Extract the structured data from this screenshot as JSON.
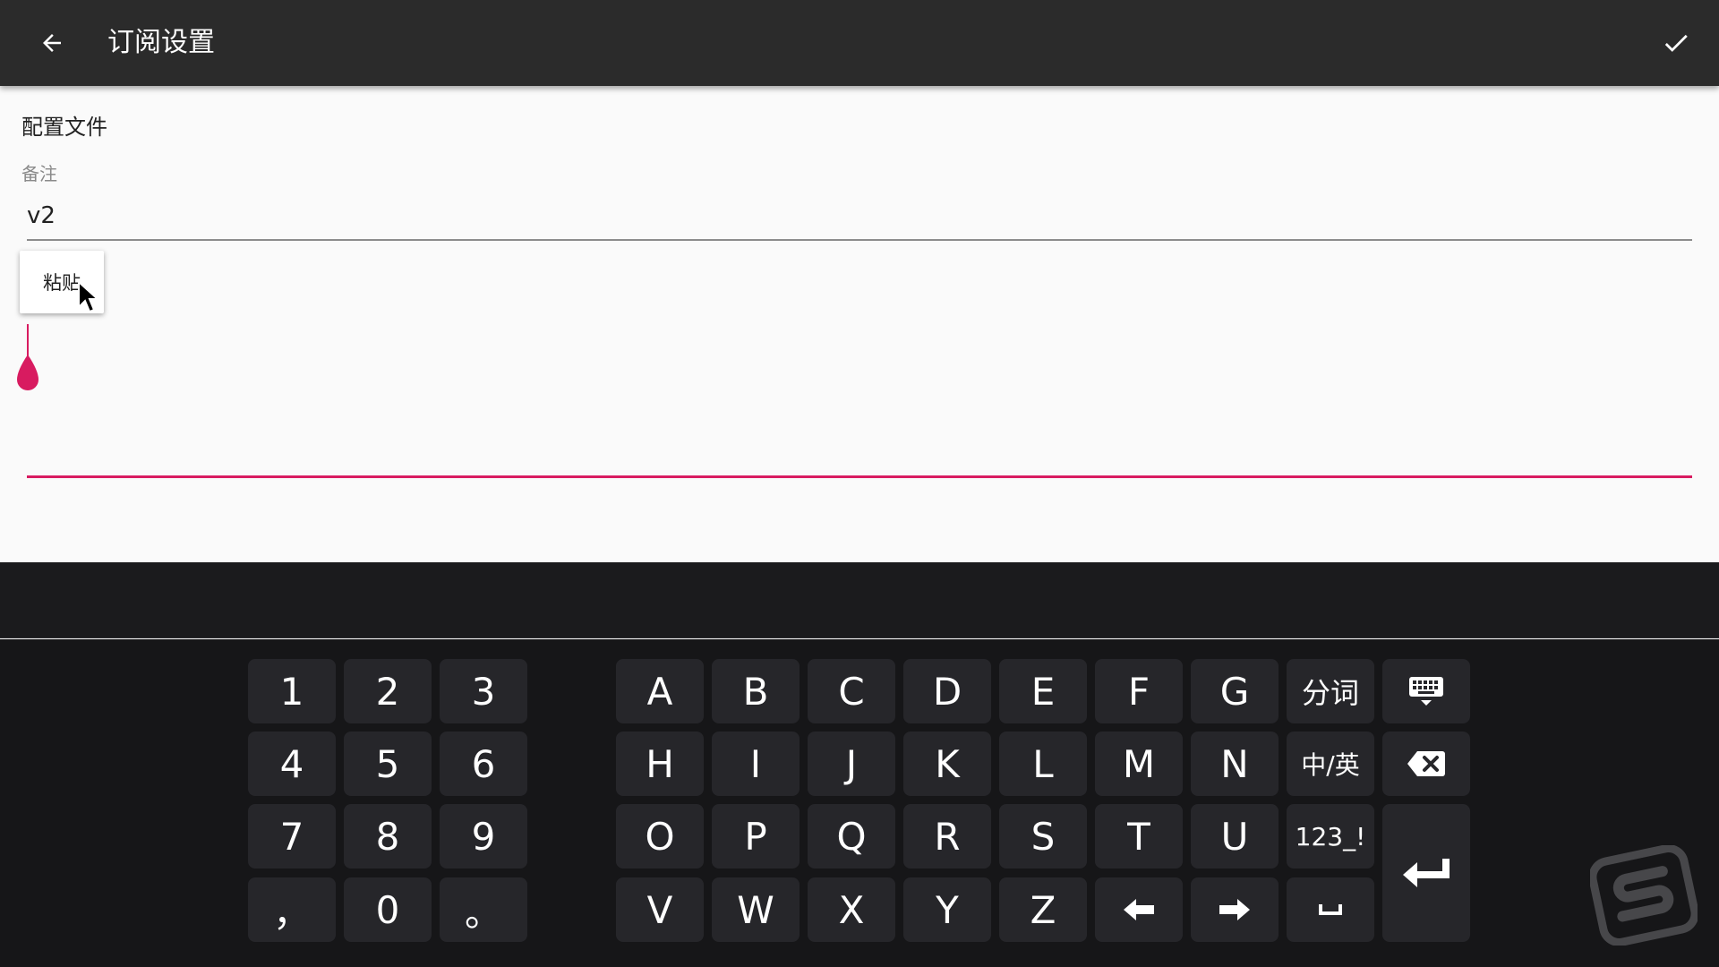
{
  "app_bar": {
    "title": "订阅设置",
    "back_icon": "arrow-left-icon",
    "confirm_icon": "check-icon"
  },
  "form": {
    "section_title": "配置文件",
    "remarks_label": "备注",
    "remarks_value": "v2",
    "paste_label": "粘贴",
    "accent_color": "#d81b60"
  },
  "keyboard": {
    "numpad": [
      "1",
      "2",
      "3",
      "4",
      "5",
      "6",
      "7",
      "8",
      "9",
      "，",
      "0",
      "。"
    ],
    "row1": [
      "A",
      "B",
      "C",
      "D",
      "E",
      "F",
      "G",
      "分词"
    ],
    "row2": [
      "H",
      "I",
      "J",
      "K",
      "L",
      "M",
      "N",
      "中/英"
    ],
    "row3": [
      "O",
      "P",
      "Q",
      "R",
      "S",
      "T",
      "U",
      "123_!"
    ],
    "row4": [
      "V",
      "W",
      "X",
      "Y",
      "Z"
    ],
    "icons": {
      "hide": "keyboard-hide-icon",
      "backspace": "backspace-icon",
      "enter": "enter-icon",
      "left": "arrow-left-key-icon",
      "right": "arrow-right-key-icon",
      "space": "space-icon"
    }
  }
}
